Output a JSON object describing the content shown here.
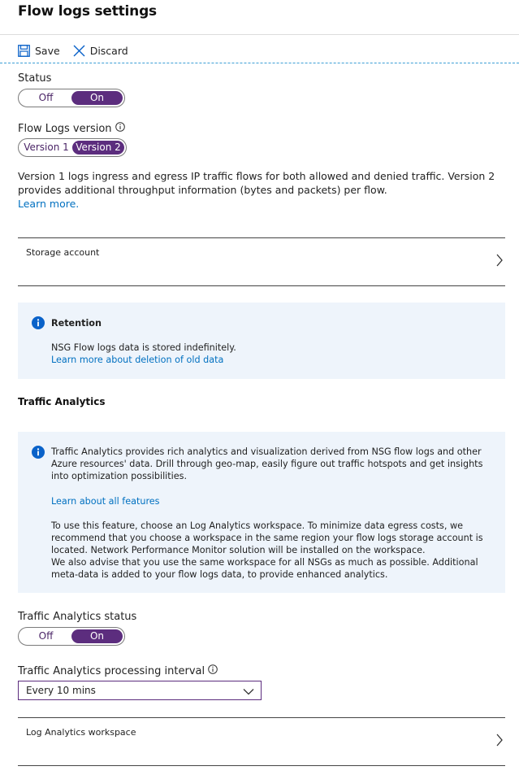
{
  "page": {
    "title": "Flow logs settings"
  },
  "toolbar": {
    "save_label": "Save",
    "discard_label": "Discard"
  },
  "status": {
    "label": "Status",
    "off_label": "Off",
    "on_label": "On",
    "selected": "On"
  },
  "flow_logs_version": {
    "label": "Flow Logs version",
    "option1": "Version 1",
    "option2": "Version 2",
    "selected": "Version 2"
  },
  "description": {
    "text": "Version 1 logs ingress and egress IP traffic flows for both allowed and denied traffic. Version 2 provides additional throughput information (bytes and packets) per flow.",
    "learn_more": "Learn more."
  },
  "storage_account": {
    "label": "Storage account"
  },
  "retention": {
    "title": "Retention",
    "text": "NSG Flow logs data is stored indefinitely.",
    "link": "Learn more about deletion of old data"
  },
  "traffic_analytics": {
    "section_title": "Traffic Analytics",
    "info_text": "Traffic Analytics provides rich analytics and visualization derived from NSG flow logs and other Azure resources' data. Drill through geo-map, easily figure out traffic hotspots and get insights into optimization possibilities.",
    "features_link": "Learn about all features",
    "workspace_text": "To use this feature, choose an Log Analytics workspace. To minimize data egress costs, we recommend that you choose a workspace in the same region your flow logs storage account is located. Network Performance Monitor solution will be installed on the workspace.",
    "advise_text": "We also advise that you use the same workspace for all NSGs as much as possible. Additional meta-data is added to your flow logs data, to provide enhanced analytics.",
    "status_label": "Traffic Analytics status",
    "status_off": "Off",
    "status_on": "On",
    "status_selected": "On",
    "interval_label": "Traffic Analytics processing interval",
    "interval_value": "Every 10 mins",
    "workspace_label": "Log Analytics workspace"
  },
  "colors": {
    "accent": "#5c2d7e",
    "link": "#0070c0",
    "info_bg": "#eef4fb",
    "info_icon": "#0a62c9"
  },
  "icons": [
    "save-icon",
    "close-icon",
    "info-circle-icon",
    "chevron-right-icon",
    "chevron-down-icon"
  ]
}
